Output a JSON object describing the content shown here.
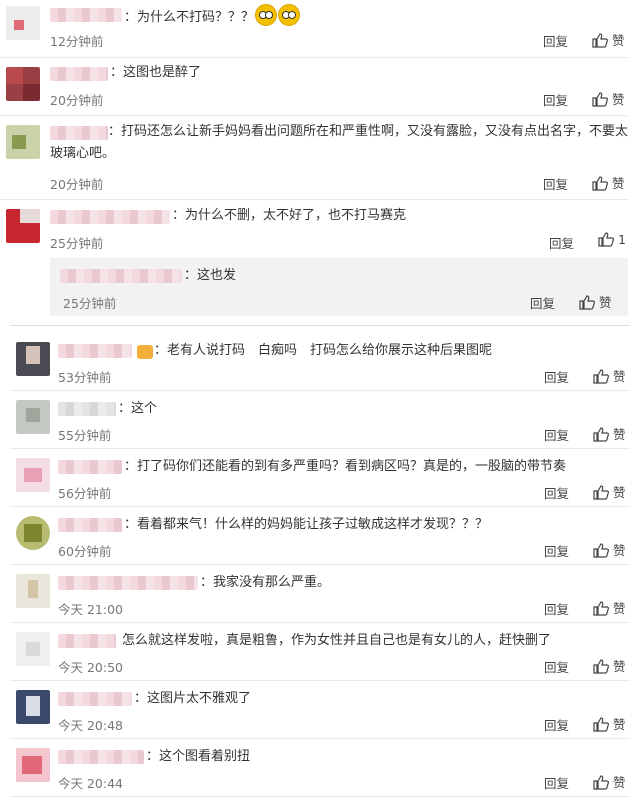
{
  "comments": [
    {
      "text": "：为什么不打码？？？",
      "time": "12分钟前",
      "reply": "回复",
      "like": "赞",
      "avatar_color": "#d8d8d8"
    },
    {
      "text": "：这图也是醉了",
      "time": "20分钟前",
      "reply": "回复",
      "like": "赞",
      "avatar_color": "#b0383c"
    },
    {
      "text": "：打码还怎么让新手妈妈看出问题所在和严重性啊，又没有露脸，又没有点出名字，不要太玻璃心吧。",
      "time": "20分钟前",
      "reply": "回复",
      "like": "赞",
      "avatar_color": "#a9b97a"
    },
    {
      "text": "：为什么不删，太不好了，也不打马赛克",
      "time": "25分钟前",
      "reply": "回复",
      "like": "1",
      "avatar_color": "#c8262e"
    }
  ],
  "sub_reply": {
    "text": "：这也发",
    "time": "25分钟前",
    "reply": "回复",
    "like": "赞"
  },
  "comments2": [
    {
      "text": "：老有人说打码　白痴吗　打码怎么给你展示这种后果图呢",
      "time": "53分钟前",
      "reply": "回复",
      "like": "赞",
      "avatar_color": "#4a4a52"
    },
    {
      "text": "：这个",
      "time": "55分钟前",
      "reply": "回复",
      "like": "赞",
      "avatar_color": "#c4c8c2"
    },
    {
      "text": "：打了码你们还能看的到有多严重吗？看到病区吗？真是的，一股脑的带节奏",
      "time": "56分钟前",
      "reply": "回复",
      "like": "赞",
      "avatar_color": "#e8b0c0"
    },
    {
      "text": "：看着都来气！什么样的妈妈能让孩子过敏成这样才发现？？？",
      "time": "60分钟前",
      "reply": "回复",
      "like": "赞",
      "avatar_color": "#98a040"
    },
    {
      "text": "：我家没有那么严重。",
      "time": "今天 21:00",
      "reply": "回复",
      "like": "赞",
      "avatar_color": "#e0d8c8"
    },
    {
      "text": "怎么就这样发啦，真是粗鲁，作为女性并且自己也是有女儿的人，赶快删了",
      "time": "今天 20:50",
      "reply": "回复",
      "like": "赞",
      "avatar_color": "#e6e6e6"
    },
    {
      "text": "：这图片太不雅观了",
      "time": "今天 20:48",
      "reply": "回复",
      "like": "赞",
      "avatar_color": "#3a4a6a"
    },
    {
      "text": "：这个图看着别扭",
      "time": "今天 20:44",
      "reply": "回复",
      "like": "赞",
      "avatar_color": "#e06878"
    }
  ]
}
